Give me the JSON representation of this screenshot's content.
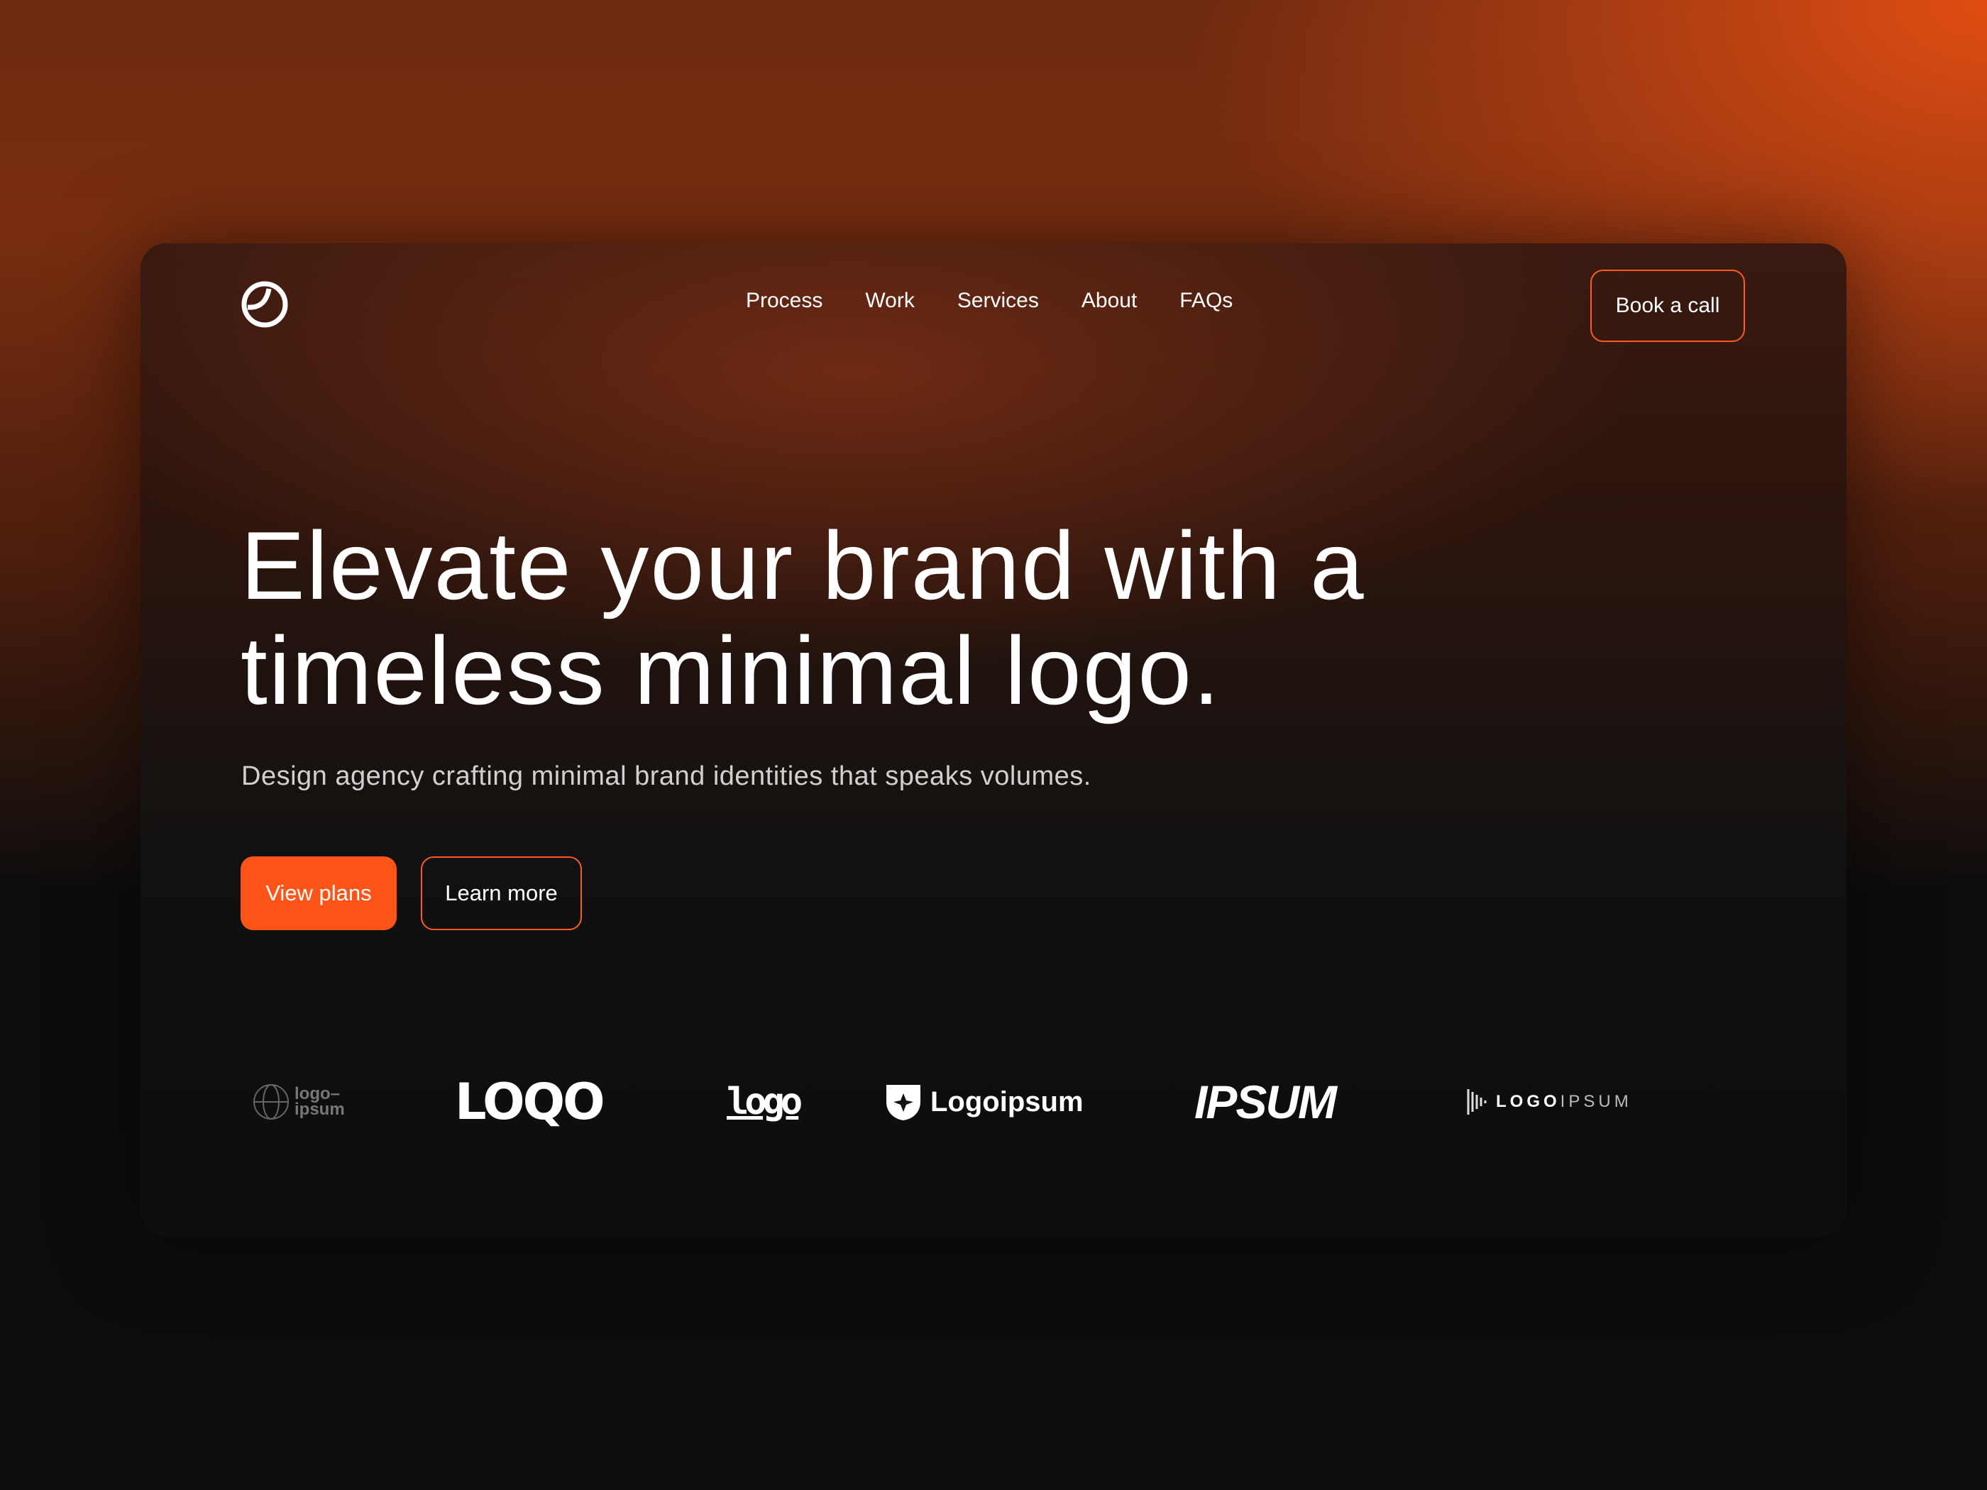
{
  "nav": {
    "items": [
      "Process",
      "Work",
      "Services",
      "About",
      "FAQs"
    ],
    "cta": "Book a call"
  },
  "hero": {
    "title_line1": "Elevate your brand with a",
    "title_line2": "timeless minimal logo.",
    "subtitle": "Design agency crafting minimal brand identities that speaks volumes.",
    "primary": "View plans",
    "secondary": "Learn more"
  },
  "logos": [
    {
      "text1": "logo–",
      "text2": "ipsum"
    },
    {
      "text": "LOQO"
    },
    {
      "text": "logo"
    },
    {
      "text": "Logoipsum"
    },
    {
      "text": "IPSUM"
    },
    {
      "text_bold": "LOGO",
      "text_light": "IPSUM"
    }
  ],
  "colors": {
    "accent": "#ff5417",
    "bg": "#0d0d0d"
  }
}
